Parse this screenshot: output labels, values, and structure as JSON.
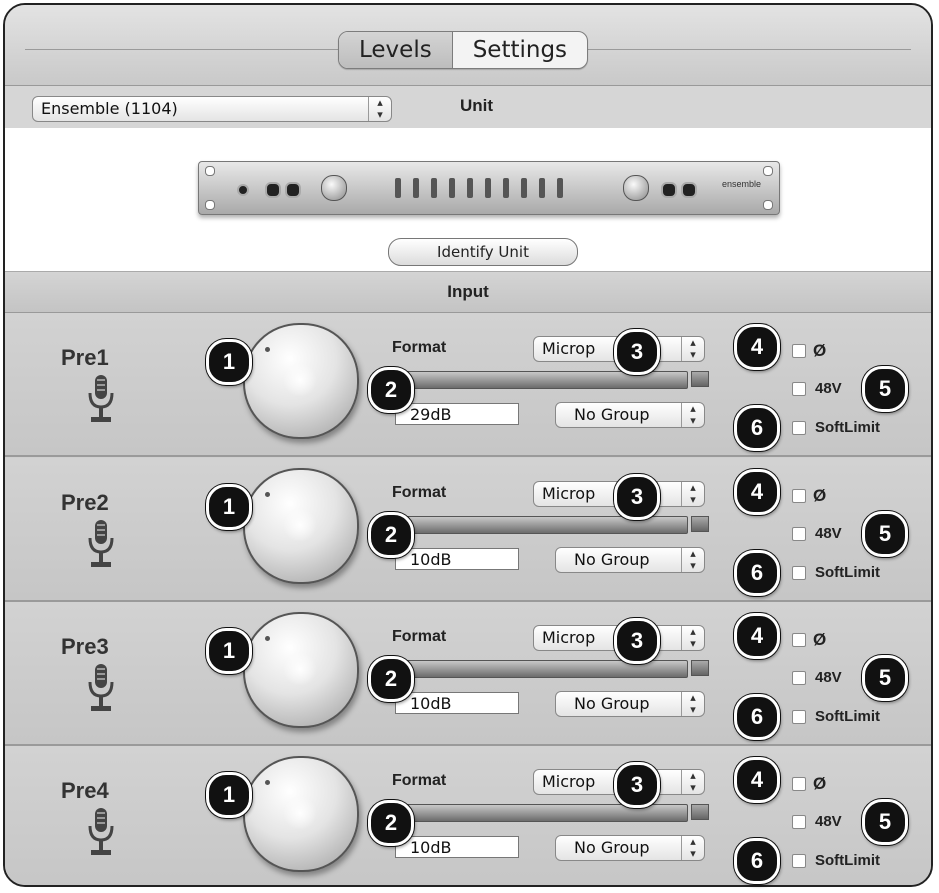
{
  "tabs": [
    {
      "label": "Levels",
      "selected": true
    },
    {
      "label": "Settings",
      "selected": false
    }
  ],
  "unit": {
    "select_value": "Ensemble (1104)",
    "label": "Unit",
    "identify_label": "Identify Unit",
    "device_logo": "ensemble"
  },
  "input_header": "Input",
  "labels": {
    "format": "Format",
    "phase": "Ø",
    "phantom": "48V",
    "softlimit": "SoftLimit",
    "format_value": "Microp",
    "group_value": "No Group"
  },
  "callouts": [
    "1",
    "2",
    "3",
    "4",
    "5",
    "6"
  ],
  "channels": [
    {
      "name": "Pre1",
      "gain": "29dB"
    },
    {
      "name": "Pre2",
      "gain": "10dB"
    },
    {
      "name": "Pre3",
      "gain": "10dB"
    },
    {
      "name": "Pre4",
      "gain": "10dB"
    }
  ],
  "icons": {
    "channel_icon": "microphone-icon",
    "stepper_icon": "up-down-arrows-icon"
  }
}
